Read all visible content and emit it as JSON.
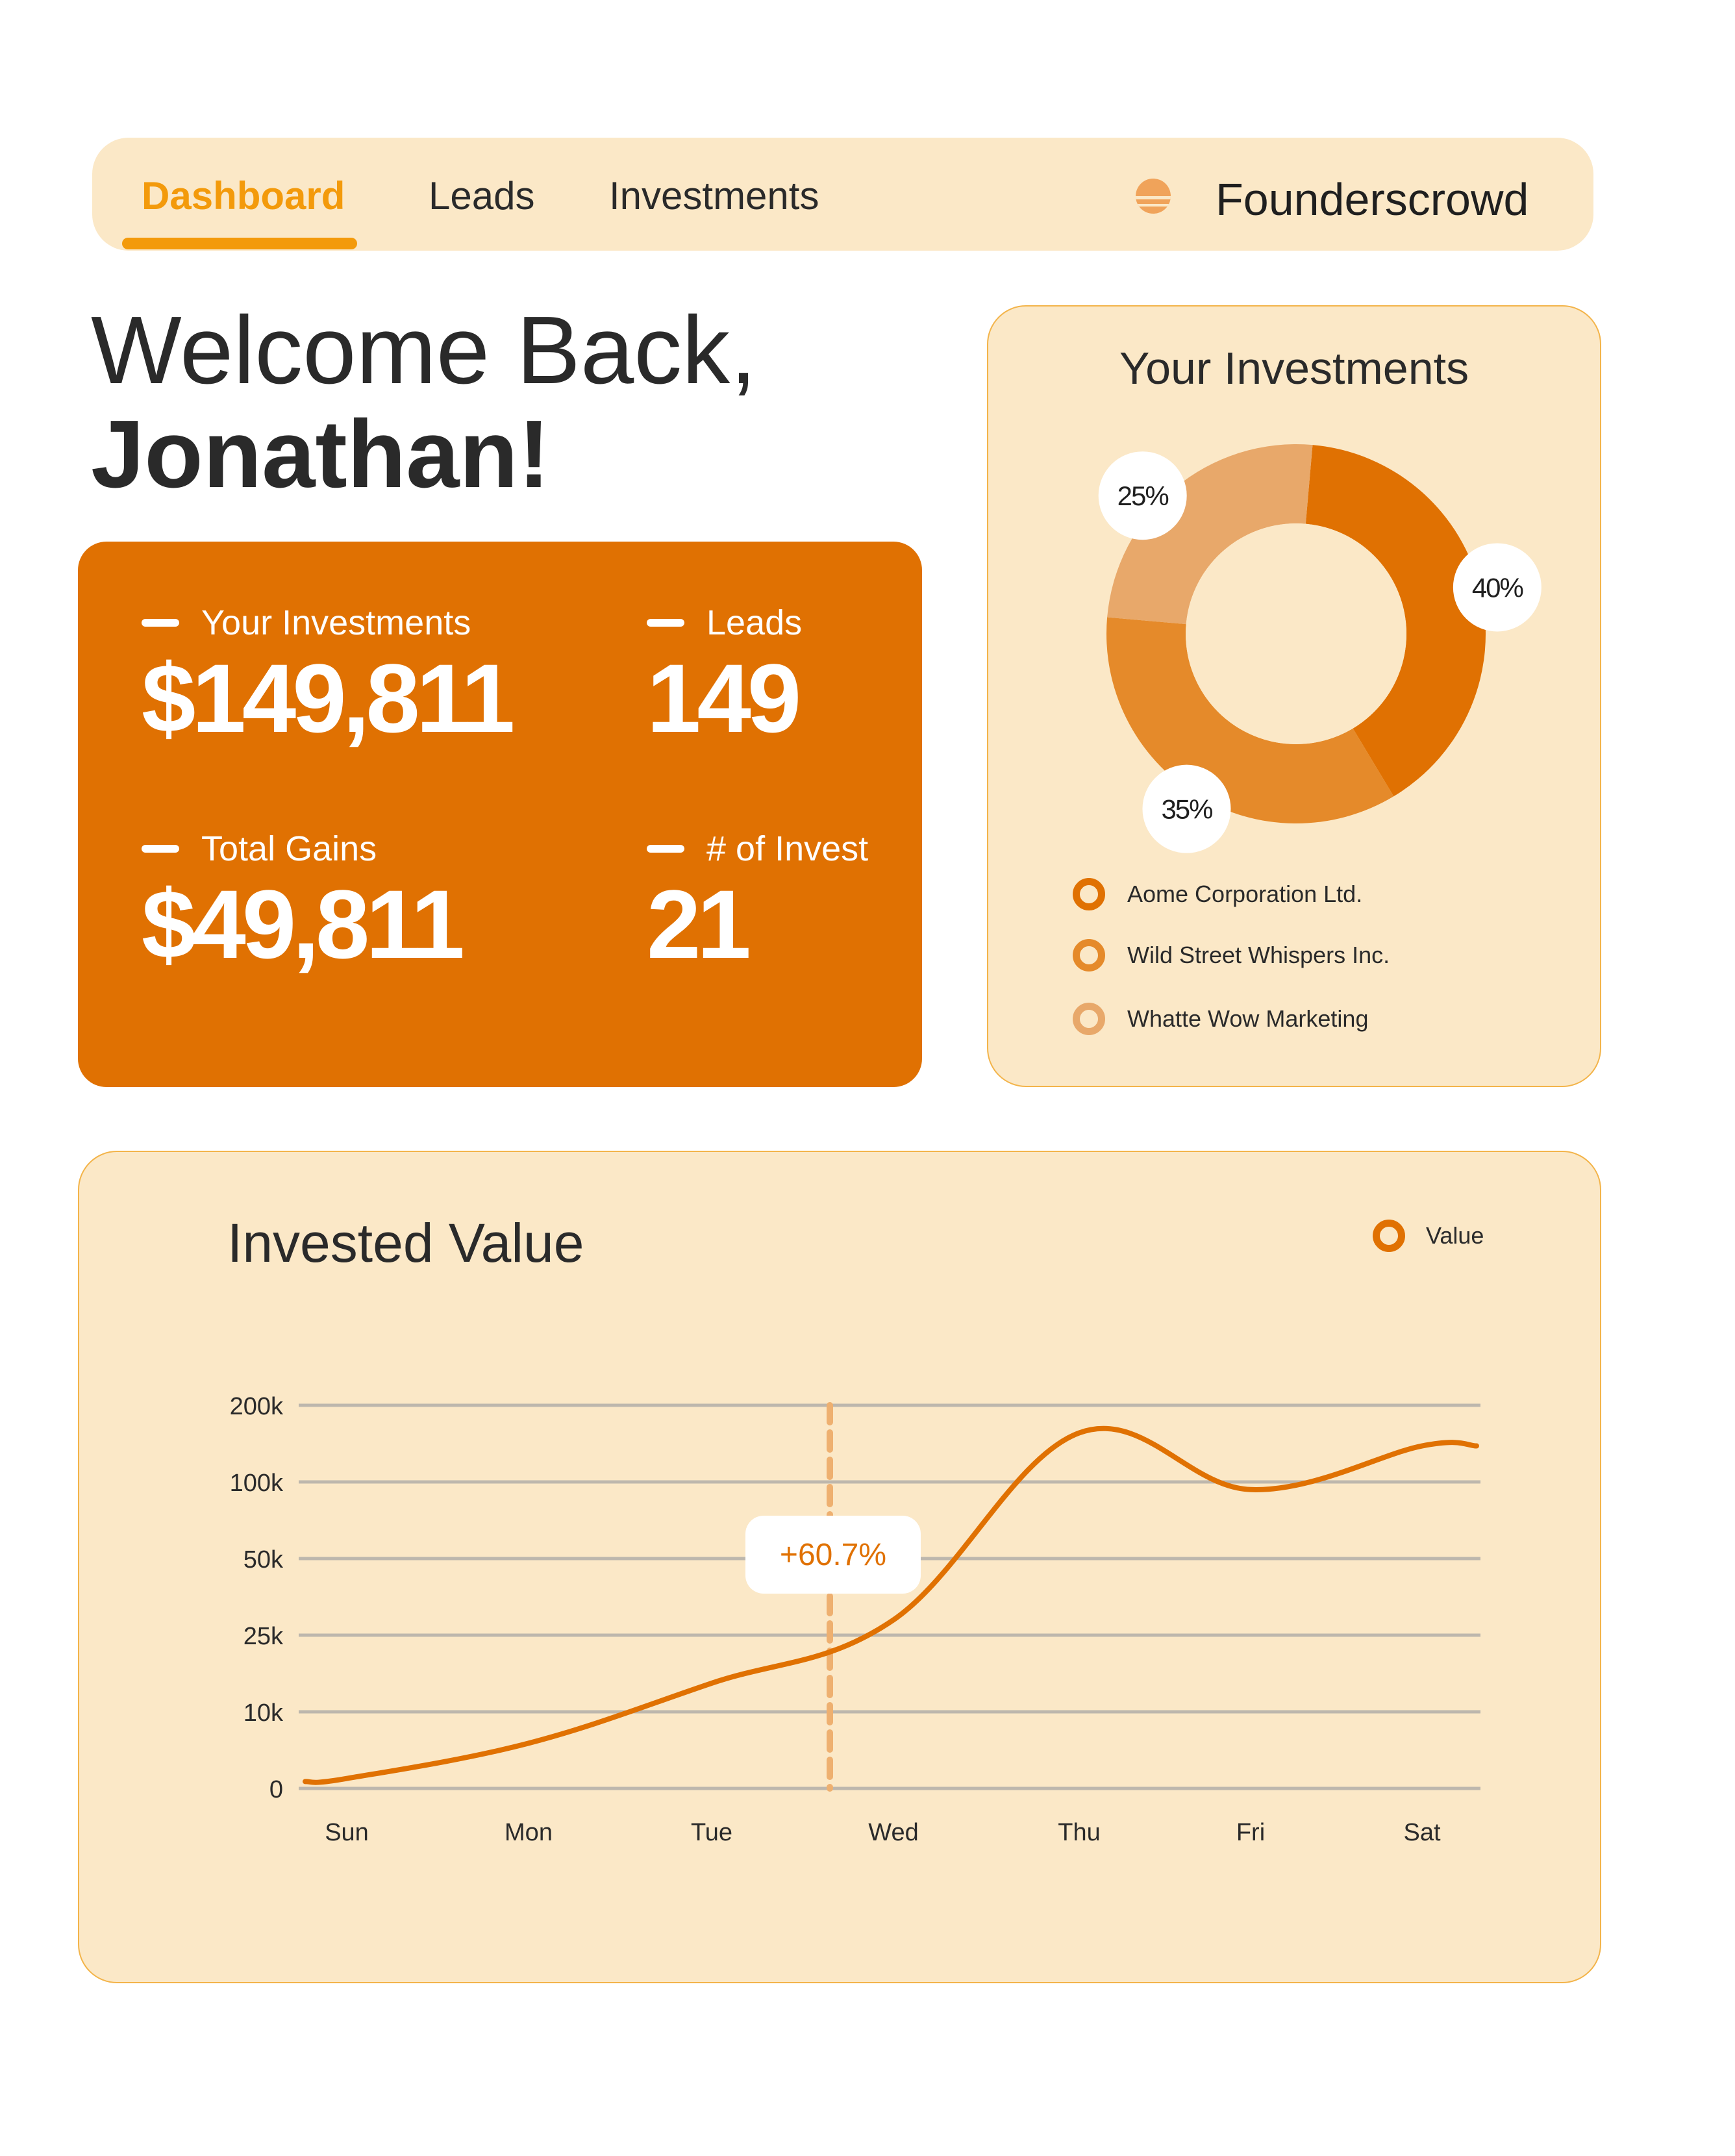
{
  "nav": {
    "tabs": [
      {
        "label": "Dashboard",
        "active": true
      },
      {
        "label": "Leads",
        "active": false
      },
      {
        "label": "Investments",
        "active": false
      }
    ],
    "brand": "Founderscrowd"
  },
  "welcome": {
    "line1": "Welcome Back,",
    "line2": "Jonathan!"
  },
  "stats": {
    "your_investments": {
      "label": "Your Investments",
      "value": "$149,811"
    },
    "leads": {
      "label": "Leads",
      "value": "149"
    },
    "total_gains": {
      "label": "Total Gains",
      "value": "$49,811"
    },
    "num_invest": {
      "label": "# of Invest",
      "value": "21"
    }
  },
  "investments_card": {
    "title": "Your Investments",
    "slices": [
      {
        "name": "Aome Corporation Ltd.",
        "percent": 40,
        "label": "40%",
        "color": "#e07102"
      },
      {
        "name": "Wild Street Whispers Inc.",
        "percent": 35,
        "label": "35%",
        "color": "#e58a2a"
      },
      {
        "name": "Whatte Wow Marketing",
        "percent": 25,
        "label": "25%",
        "color": "#e8a86a"
      }
    ]
  },
  "chart": {
    "title": "Invested Value",
    "legend_label": "Value",
    "annotation": "+60.7%"
  },
  "chart_data": {
    "type": "line",
    "title": "Invested Value",
    "x": [
      "Sun",
      "Mon",
      "Tue",
      "Wed",
      "Thu",
      "Fri",
      "Sat"
    ],
    "y_ticks": [
      "0",
      "10k",
      "25k",
      "50k",
      "100k",
      "200k"
    ],
    "series": [
      {
        "name": "Value",
        "color": "#e07102",
        "points": [
          {
            "x": "Sun",
            "y": 1.3
          },
          {
            "x": "Mon",
            "y": 5.9
          },
          {
            "x": "Tue",
            "y": 15.6
          },
          {
            "x": "Wed",
            "y": 30
          },
          {
            "x": "Thu",
            "y": 164
          },
          {
            "x": "Fri",
            "y": 95
          },
          {
            "x": "Sat",
            "y": 147
          }
        ]
      }
    ],
    "marker": {
      "label": "+60.7%",
      "between": [
        "Tue",
        "Wed"
      ]
    },
    "grid": true,
    "legend": "top-right"
  },
  "colors": {
    "accent": "#e07102",
    "nav_active": "#f39a0b",
    "card_bg": "#fbe8c7",
    "border": "#f3b44a"
  }
}
